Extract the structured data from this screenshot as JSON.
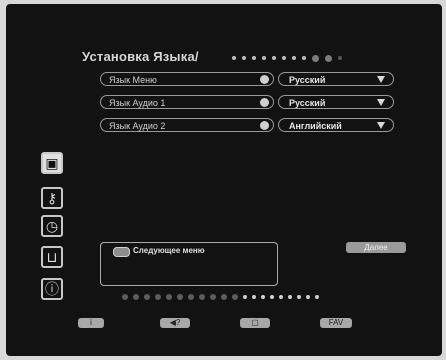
{
  "menu": {
    "title": "Установка Языка/",
    "rows": [
      {
        "label": "Язык Меню",
        "value": "Русский"
      },
      {
        "label": "Язык Аудио 1",
        "value": "Русский"
      },
      {
        "label": "Язык Аудио 2",
        "value": "Английский"
      }
    ]
  },
  "sidebar": {
    "icons": [
      {
        "name": "camera-icon",
        "glyph": "▣",
        "active": true
      },
      {
        "name": "key-icon",
        "glyph": "⚷",
        "active": false
      },
      {
        "name": "clock-icon",
        "glyph": "◷",
        "active": false
      },
      {
        "name": "folder-icon",
        "glyph": "⊔",
        "active": false
      },
      {
        "name": "info-icon",
        "glyph": "ⓘ",
        "active": false
      }
    ]
  },
  "info_panel": {
    "text": "Следующее меню",
    "next_label": "Далее"
  },
  "footer_keys": [
    {
      "name": "info-key",
      "label": "i"
    },
    {
      "name": "audio-key",
      "label": "◀?"
    },
    {
      "name": "blank-key",
      "label": "▢"
    },
    {
      "name": "fav-key",
      "label": "FAV"
    }
  ],
  "colors": {
    "screen_bg": "#121212",
    "frame_bg": "#d8d8d8",
    "text": "#d6d6d6"
  }
}
